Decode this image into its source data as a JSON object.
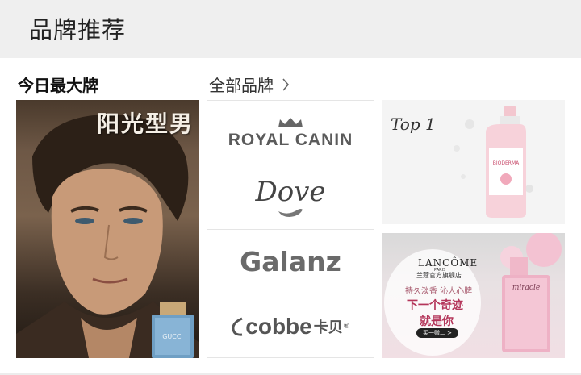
{
  "header": {
    "title": "品牌推荐"
  },
  "sections": {
    "today_label": "今日最大牌",
    "all_brands_label": "全部品牌"
  },
  "promo": {
    "title": "阳光型男",
    "bottle_label": "GUCCI"
  },
  "brands": [
    {
      "name": "ROYAL CANIN"
    },
    {
      "name": "Dove"
    },
    {
      "name": "Galanz"
    },
    {
      "name": "cobbe",
      "cn": "卡贝",
      "reg": "®"
    }
  ],
  "card_top": {
    "tag": "Top 1",
    "product": "BIODERMA"
  },
  "card_bottom": {
    "brand": "LANCÔME",
    "brand_sub": "PARIS",
    "shop": "兰蔻官方旗舰店",
    "slogan": "持久淡香 沁人心脾",
    "headline1": "下一个奇迹",
    "headline2": "就是你",
    "button": "买一赠二 >",
    "bottle_label": "miracle"
  },
  "colors": {
    "header_bg": "#efefef",
    "accent_pink": "#b4355a"
  }
}
